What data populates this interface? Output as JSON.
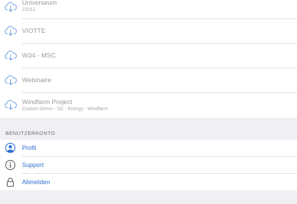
{
  "projects": [
    {
      "title": "Universeum",
      "subtitle": "22012",
      "icon": "cloud-download-icon"
    },
    {
      "title": "VIOTTE",
      "subtitle": "",
      "icon": "cloud-download-icon"
    },
    {
      "title": "W34 - MSC",
      "subtitle": "",
      "icon": "cloud-download-icon"
    },
    {
      "title": "Webinaire",
      "subtitle": "",
      "icon": "cloud-download-icon"
    },
    {
      "title": "Windfarm Project",
      "subtitle": "Custom Demo - SC - Energy - Windfarm",
      "icon": "cloud-download-icon"
    }
  ],
  "account": {
    "header": "BENUTZERKONTO",
    "items": [
      {
        "label": "Profil",
        "icon": "user-circle-icon"
      },
      {
        "label": "Support",
        "icon": "info-circle-icon"
      },
      {
        "label": "Abmelden",
        "icon": "lock-icon"
      }
    ]
  },
  "colors": {
    "accent": "#2f6fd0",
    "background": "#efeff4",
    "muted_text": "#9a9aa0",
    "icon_blue": "#4a86d8"
  }
}
